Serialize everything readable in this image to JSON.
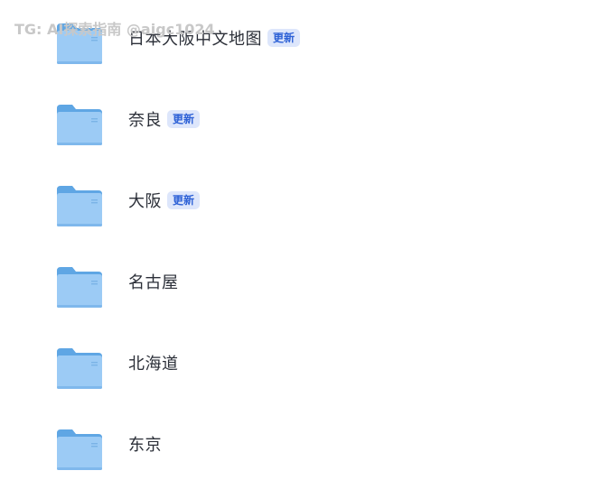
{
  "watermark": "TG: AI探索指南 @aigc1024",
  "files": [
    {
      "name": "日本大阪中文地图",
      "badge": "更新",
      "icon": "folder-icon"
    },
    {
      "name": "奈良",
      "badge": "更新",
      "icon": "folder-icon"
    },
    {
      "name": "大阪",
      "badge": "更新",
      "icon": "folder-icon"
    },
    {
      "name": "名古屋",
      "badge": "",
      "icon": "folder-icon"
    },
    {
      "name": "北海道",
      "badge": "",
      "icon": "folder-icon"
    },
    {
      "name": "东京",
      "badge": "",
      "icon": "folder-icon"
    }
  ],
  "colors": {
    "folder_back": "#6aaee8",
    "folder_front": "#a3d0f7",
    "badge_bg": "#dde6fb",
    "badge_text": "#2d61d6"
  }
}
